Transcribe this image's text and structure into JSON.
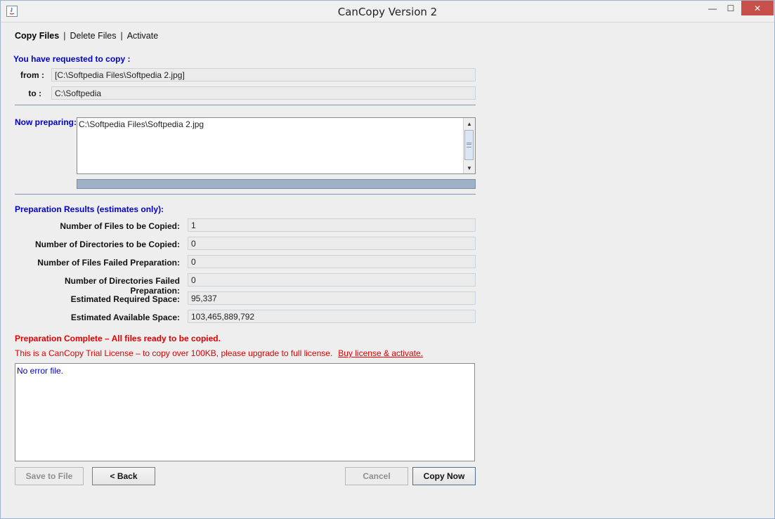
{
  "window": {
    "title": "CanCopy Version 2",
    "controls": {
      "minimize": "—",
      "maximize": "☐",
      "close": "✕"
    },
    "close_color": "#c7504b"
  },
  "nav": {
    "copy_files": "Copy Files",
    "delete_files": "Delete Files",
    "activate": "Activate",
    "separator": "|"
  },
  "request": {
    "heading": "You have requested to copy :",
    "from_label": "from :",
    "from_value": "[C:\\Softpedia Files\\Softpedia 2.jpg]",
    "to_label": "to :",
    "to_value": "C:\\Softpedia"
  },
  "preparing": {
    "label": "Now preparing:",
    "text": "C:\\Softpedia Files\\Softpedia 2.jpg",
    "progress": 1.0
  },
  "results": {
    "heading": "Preparation Results (estimates only):",
    "rows": [
      {
        "label": "Number of Files to be Copied:",
        "value": "1"
      },
      {
        "label": "Number of Directories to be Copied:",
        "value": "0"
      },
      {
        "label": "Number of Files Failed Preparation:",
        "value": "0"
      },
      {
        "label": "Number of Directories Failed Preparation:",
        "value": "0"
      },
      {
        "label": "Estimated Required Space:",
        "value": "95,337"
      },
      {
        "label": "Estimated Available Space:",
        "value": "103,465,889,792"
      }
    ]
  },
  "status": {
    "complete": "Preparation Complete – All files ready to be copied.",
    "trial": "This is a CanCopy Trial License – to copy over 100KB, please upgrade to full license.",
    "buy_link": "Buy license & activate."
  },
  "errors": {
    "text": "No error file."
  },
  "buttons": {
    "save": "Save to File",
    "back": "< Back",
    "cancel": "Cancel",
    "copy_now": "Copy Now"
  },
  "colors": {
    "section_blue": "#0000c8",
    "warning_red": "#e00000"
  }
}
